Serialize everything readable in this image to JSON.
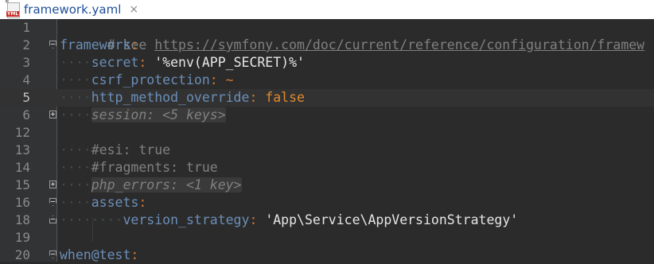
{
  "tab": {
    "modified_marker": "*",
    "title": "framework.yaml",
    "close": "×",
    "icon_label": "YML"
  },
  "lines": [
    {
      "num": "1"
    },
    {
      "num": "2"
    },
    {
      "num": "3"
    },
    {
      "num": "4"
    },
    {
      "num": "5"
    },
    {
      "num": "6"
    },
    {
      "num": "12"
    },
    {
      "num": "13"
    },
    {
      "num": "14"
    },
    {
      "num": "15"
    },
    {
      "num": "16"
    },
    {
      "num": "18"
    },
    {
      "num": "19"
    },
    {
      "num": "20"
    }
  ],
  "code": {
    "l1_comment": "# see ",
    "l1_url": "https://symfony.com/doc/current/reference/configuration/framew",
    "l2_key": "framework",
    "colon": ":",
    "l3_key": "secret",
    "l3_value": "'%env(APP_SECRET)%'",
    "l4_key": "csrf_protection",
    "l4_value": "~",
    "l5_key": "http_method_override",
    "l5_value": "false",
    "l6_folded": "session: <5 keys>",
    "l13_comment": "#esi: true",
    "l14_comment": "#fragments: true",
    "l15_folded": "php_errors: <1 key>",
    "l16_key": "assets",
    "l18_key": "version_strategy",
    "l18_value": "'App\\Service\\AppVersionStrategy'",
    "l20_key": "when@test"
  },
  "colors": {
    "background": "#2b2b2b",
    "gutter": "#313335",
    "key": "#6b8fb8",
    "boolean": "#e08a2e",
    "comment": "#808080"
  }
}
